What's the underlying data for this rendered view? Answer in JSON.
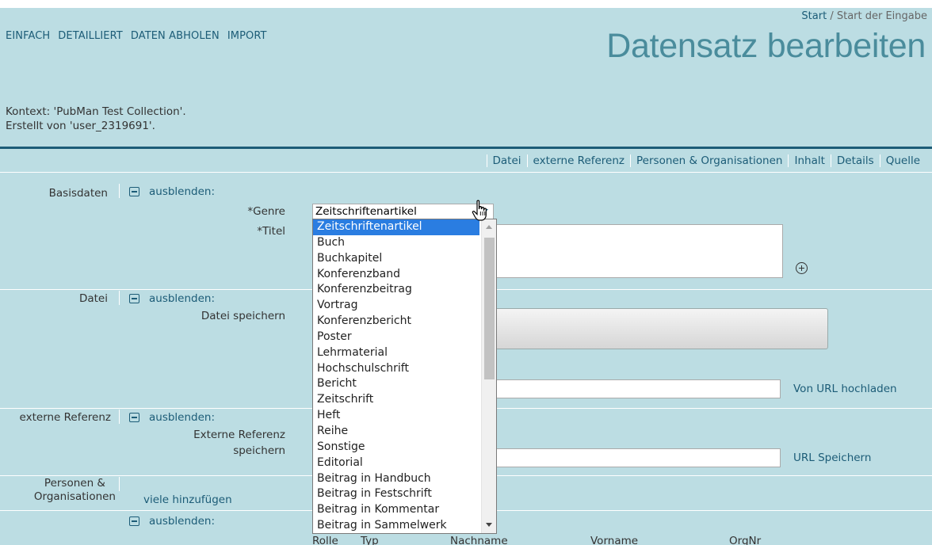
{
  "nav": {
    "items": [
      "EINFACH",
      "DETAILLIERT",
      "DATEN ABHOLEN",
      "IMPORT"
    ]
  },
  "breadcrumb": {
    "start": "Start",
    "separator": " / ",
    "current": "Start der Eingabe"
  },
  "page_title": "Datensatz bearbeiten",
  "context": {
    "line1": "Kontext: 'PubMan Test Collection'.",
    "line2": "Erstellt von 'user_2319691'."
  },
  "section_links": [
    "Datei",
    "externe Referenz",
    "Personen & Organisationen",
    "Inhalt",
    "Details",
    "Quelle"
  ],
  "toggle_label": "ausblenden:",
  "basis": {
    "label": "Basisdaten",
    "genre_label": "*Genre",
    "genre_value": "Zeitschriftenartikel",
    "title_label": "*Titel"
  },
  "datei": {
    "label": "Datei",
    "save_label": "Datei speichern",
    "url_action": "Von URL hochladen"
  },
  "extref": {
    "label": "externe Referenz",
    "save_label_1": "Externe Referenz",
    "save_label_2": "speichern",
    "url_action": "URL Speichern"
  },
  "persons": {
    "label_1": "Personen &",
    "label_2": "Organisationen",
    "multi_add": "viele hinzufügen",
    "columns": [
      "Rolle",
      "Typ",
      "Nachname",
      "Vorname",
      "OrgNr"
    ]
  },
  "genre_options": [
    "Zeitschriftenartikel",
    "Buch",
    "Buchkapitel",
    "Konferenzband",
    "Konferenzbeitrag",
    "Vortrag",
    "Konferenzbericht",
    "Poster",
    "Lehrmaterial",
    "Hochschulschrift",
    "Bericht",
    "Zeitschrift",
    "Heft",
    "Reihe",
    "Sonstige",
    "Editorial",
    "Beitrag in Handbuch",
    "Beitrag in Festschrift",
    "Beitrag in Kommentar",
    "Beitrag in Sammelwerk"
  ],
  "colors": {
    "background": "#bcdde3",
    "link": "#1c5c77",
    "title": "#4a8c9c",
    "selection": "#2a7de1"
  }
}
